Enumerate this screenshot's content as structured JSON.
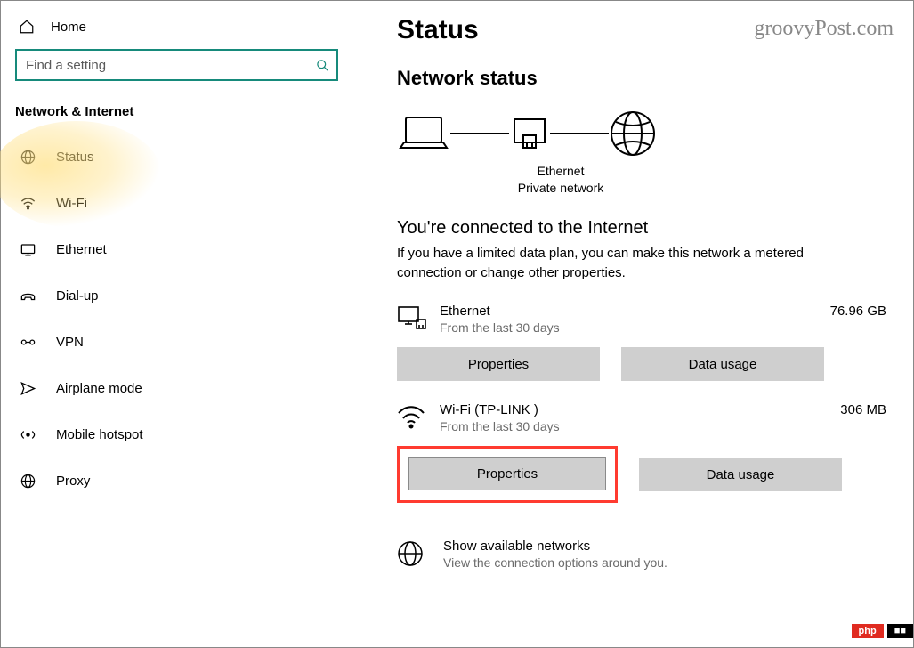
{
  "home": "Home",
  "search": {
    "placeholder": "Find a setting"
  },
  "sectionTitle": "Network & Internet",
  "sidebar": {
    "items": [
      {
        "label": "Status"
      },
      {
        "label": "Wi-Fi"
      },
      {
        "label": "Ethernet"
      },
      {
        "label": "Dial-up"
      },
      {
        "label": "VPN"
      },
      {
        "label": "Airplane mode"
      },
      {
        "label": "Mobile hotspot"
      },
      {
        "label": "Proxy"
      }
    ]
  },
  "watermark": "groovyPost.com",
  "pageTitle": "Status",
  "statusHeading": "Network status",
  "diagram": {
    "midLabel": "Ethernet",
    "midSub": "Private network"
  },
  "connectedHeading": "You're connected to the Internet",
  "connectedDesc": "If you have a limited data plan, you can make this network a metered connection or change other properties.",
  "networks": [
    {
      "name": "Ethernet",
      "sub": "From the last 30 days",
      "size": "76.96 GB",
      "propBtn": "Properties",
      "usageBtn": "Data usage"
    },
    {
      "name": "Wi-Fi (TP-LINK               )",
      "sub": "From the last 30 days",
      "size": "306 MB",
      "propBtn": "Properties",
      "usageBtn": "Data usage"
    }
  ],
  "available": {
    "title": "Show available networks",
    "sub": "View the connection options around you."
  },
  "badge": {
    "php": "php",
    "cn": "■■"
  }
}
